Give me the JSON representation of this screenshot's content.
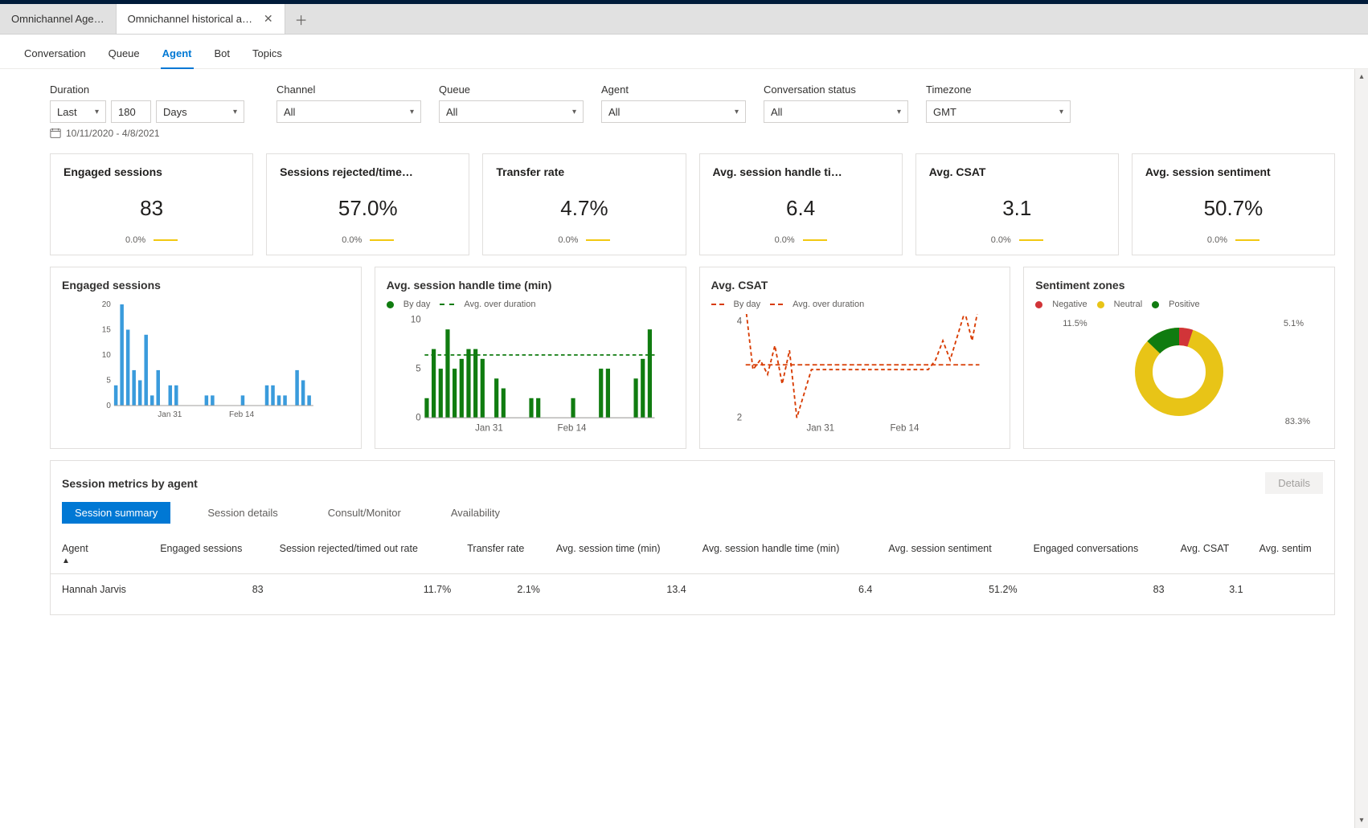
{
  "tabs": {
    "inactive": "Omnichannel Age…",
    "active": "Omnichannel historical an…"
  },
  "subtabs": [
    "Conversation",
    "Queue",
    "Agent",
    "Bot",
    "Topics"
  ],
  "filters": {
    "duration": {
      "label": "Duration",
      "mode": "Last",
      "value": "180",
      "unit": "Days"
    },
    "channel": {
      "label": "Channel",
      "value": "All"
    },
    "queue": {
      "label": "Queue",
      "value": "All"
    },
    "agent": {
      "label": "Agent",
      "value": "All"
    },
    "status": {
      "label": "Conversation status",
      "value": "All"
    },
    "timezone": {
      "label": "Timezone",
      "value": "GMT"
    },
    "daterange": "10/11/2020 - 4/8/2021"
  },
  "kpis": [
    {
      "title": "Engaged sessions",
      "value": "83",
      "delta": "0.0%"
    },
    {
      "title": "Sessions rejected/time…",
      "value": "57.0%",
      "delta": "0.0%"
    },
    {
      "title": "Transfer rate",
      "value": "4.7%",
      "delta": "0.0%"
    },
    {
      "title": "Avg. session handle ti…",
      "value": "6.4",
      "delta": "0.0%"
    },
    {
      "title": "Avg. CSAT",
      "value": "3.1",
      "delta": "0.0%"
    },
    {
      "title": "Avg. session sentiment",
      "value": "50.7%",
      "delta": "0.0%"
    }
  ],
  "charts": {
    "engaged": {
      "title": "Engaged sessions"
    },
    "handle": {
      "title": "Avg. session handle time (min)",
      "legend": [
        "By day",
        "Avg. over duration"
      ]
    },
    "csat": {
      "title": "Avg. CSAT",
      "legend": [
        "By day",
        "Avg. over duration"
      ]
    },
    "sentiment": {
      "title": "Sentiment zones",
      "legend": [
        "Negative",
        "Neutral",
        "Positive"
      ],
      "labels": {
        "neg": "5.1%",
        "neu": "83.3%",
        "pos": "11.5%"
      }
    }
  },
  "chart_data": [
    {
      "type": "bar",
      "title": "Engaged sessions",
      "ylim": [
        0,
        20
      ],
      "yticks": [
        0,
        5,
        10,
        15,
        20
      ],
      "xticks": [
        "Jan 31",
        "Feb 14"
      ],
      "values": [
        4,
        20,
        15,
        7,
        5,
        14,
        2,
        7,
        0,
        4,
        4,
        0,
        0,
        0,
        0,
        2,
        2,
        0,
        0,
        0,
        0,
        2,
        0,
        0,
        0,
        4,
        4,
        2,
        2,
        0,
        7,
        5,
        2
      ]
    },
    {
      "type": "bar",
      "title": "Avg. session handle time (min)",
      "ylim": [
        0,
        10
      ],
      "yticks": [
        0,
        5,
        10
      ],
      "xticks": [
        "Jan 31",
        "Feb 14"
      ],
      "series": [
        {
          "name": "By day",
          "values": [
            2,
            7,
            5,
            9,
            5,
            6,
            7,
            7,
            6,
            0,
            4,
            3,
            0,
            0,
            0,
            2,
            2,
            0,
            0,
            0,
            0,
            2,
            0,
            0,
            0,
            5,
            5,
            0,
            0,
            0,
            4,
            6,
            9
          ]
        }
      ],
      "avg_over_duration": 6.4
    },
    {
      "type": "line",
      "title": "Avg. CSAT",
      "ylim": [
        2,
        4
      ],
      "yticks": [
        2,
        4
      ],
      "xticks": [
        "Jan 31",
        "Feb 14"
      ],
      "series": [
        {
          "name": "By day",
          "values": [
            4.3,
            3.0,
            3.2,
            2.9,
            3.5,
            2.7,
            3.4,
            2.0,
            2.5,
            3.0,
            3.0,
            3.0,
            3.0,
            3.0,
            3.0,
            3.0,
            3.0,
            3.0,
            3.0,
            3.0,
            3.0,
            3.0,
            3.0,
            3.0,
            3.0,
            3.0,
            3.2,
            3.6,
            3.2,
            3.7,
            4.2,
            3.6,
            4.4
          ]
        }
      ],
      "avg_over_duration": 3.1
    },
    {
      "type": "pie",
      "title": "Sentiment zones",
      "series": [
        {
          "name": "Negative",
          "value": 5.1
        },
        {
          "name": "Neutral",
          "value": 83.3
        },
        {
          "name": "Positive",
          "value": 11.5
        }
      ]
    }
  ],
  "metrics_table": {
    "title": "Session metrics by agent",
    "details_label": "Details",
    "tabs": [
      "Session summary",
      "Session details",
      "Consult/Monitor",
      "Availability"
    ],
    "columns": [
      "Agent",
      "Engaged sessions",
      "Session rejected/timed out rate",
      "Transfer rate",
      "Avg. session time (min)",
      "Avg. session handle time (min)",
      "Avg. session sentiment",
      "Engaged conversations",
      "Avg. CSAT",
      "Avg. sentim"
    ],
    "rows": [
      {
        "agent": "Hannah Jarvis",
        "engaged": "83",
        "rejected": "11.7%",
        "transfer": "2.1%",
        "session_time": "13.4",
        "handle_time": "6.4",
        "sentiment": "51.2%",
        "conversations": "83",
        "csat": "3.1",
        "avg_sentim": ""
      }
    ]
  }
}
